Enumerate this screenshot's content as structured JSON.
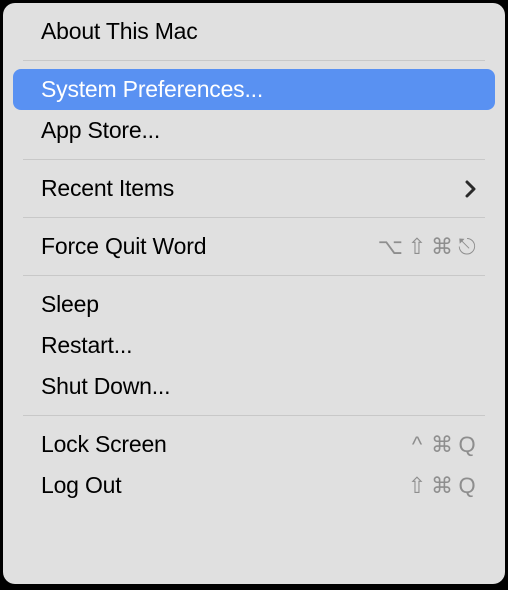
{
  "menu": {
    "items": [
      {
        "label": "About This Mac"
      },
      {
        "label": "System Preferences...",
        "highlighted": true
      },
      {
        "label": "App Store..."
      },
      {
        "label": "Recent Items",
        "hasSubmenu": true
      },
      {
        "label": "Force Quit Word",
        "shortcut": [
          "⌥",
          "⇧",
          "⌘",
          "⎋"
        ]
      },
      {
        "label": "Sleep"
      },
      {
        "label": "Restart..."
      },
      {
        "label": "Shut Down..."
      },
      {
        "label": "Lock Screen",
        "shortcut": [
          "^",
          "⌘",
          "Q"
        ]
      },
      {
        "label": "Log Out",
        "shortcut": [
          "⇧",
          "⌘",
          "Q"
        ]
      }
    ]
  }
}
